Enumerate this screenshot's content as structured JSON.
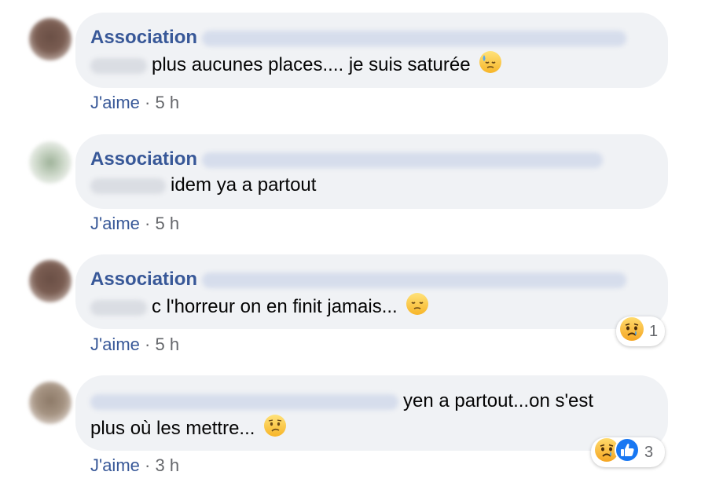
{
  "comments": [
    {
      "author": "Association",
      "text": "plus aucunes places.... je suis saturée",
      "emoji": "downcast-sweat-emoji",
      "like_label": "J'aime",
      "separator": "·",
      "time": "5 h"
    },
    {
      "author": "Association",
      "text": "idem ya a partout",
      "like_label": "J'aime",
      "separator": "·",
      "time": "5 h"
    },
    {
      "author": "Association",
      "text": "c l'horreur on en finit jamais...",
      "emoji": "pensive-emoji",
      "like_label": "J'aime",
      "separator": "·",
      "time": "5 h",
      "reactions": {
        "icons": [
          "sad-reaction-icon"
        ],
        "count": "1"
      }
    },
    {
      "text_line1": "yen a partout...on s'est",
      "text_line2": "plus où les mettre...",
      "emoji": "worried-emoji",
      "like_label": "J'aime",
      "separator": "·",
      "time": "3 h",
      "reactions": {
        "icons": [
          "sad-reaction-icon",
          "like-reaction-icon"
        ],
        "count": "3"
      }
    }
  ],
  "colors": {
    "bubble": "#f0f2f5",
    "author": "#385898",
    "meta": "#65676b",
    "like_blue": "#1877f2"
  }
}
